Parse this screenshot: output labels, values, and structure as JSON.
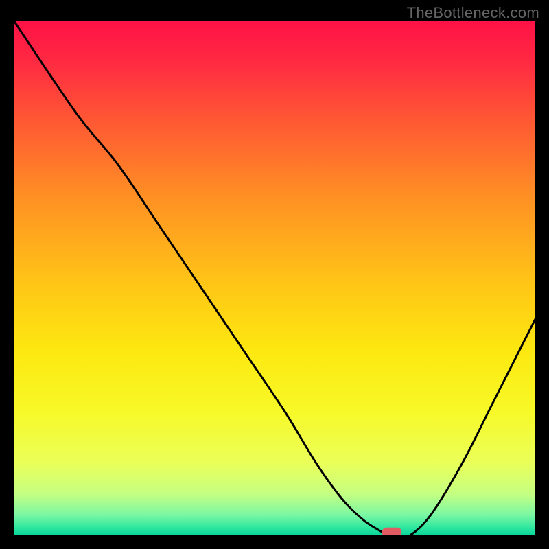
{
  "watermark": "TheBottleneck.com",
  "chart_data": {
    "type": "line",
    "title": "",
    "xlabel": "",
    "ylabel": "",
    "xlim": [
      0,
      100
    ],
    "ylim": [
      0,
      100
    ],
    "x": [
      0,
      12,
      20,
      28,
      36,
      44,
      52,
      58,
      63,
      67,
      70,
      72,
      74,
      76,
      80,
      86,
      92,
      100
    ],
    "values": [
      100,
      82,
      72,
      60,
      48,
      36,
      24,
      14,
      7,
      3,
      1,
      0,
      0,
      0,
      4,
      14,
      26,
      42
    ],
    "marker": {
      "x": 72.5,
      "y": 0.3
    },
    "background_gradient": {
      "stops": [
        {
          "offset": 0.0,
          "color": "#ff1146"
        },
        {
          "offset": 0.08,
          "color": "#ff2a42"
        },
        {
          "offset": 0.2,
          "color": "#ff5a33"
        },
        {
          "offset": 0.34,
          "color": "#ff8f24"
        },
        {
          "offset": 0.5,
          "color": "#ffc217"
        },
        {
          "offset": 0.64,
          "color": "#fde810"
        },
        {
          "offset": 0.76,
          "color": "#f7f928"
        },
        {
          "offset": 0.86,
          "color": "#eaff59"
        },
        {
          "offset": 0.92,
          "color": "#c4ff82"
        },
        {
          "offset": 0.96,
          "color": "#7cf7a3"
        },
        {
          "offset": 0.985,
          "color": "#2fe7a0"
        },
        {
          "offset": 1.0,
          "color": "#05d49b"
        }
      ]
    }
  }
}
